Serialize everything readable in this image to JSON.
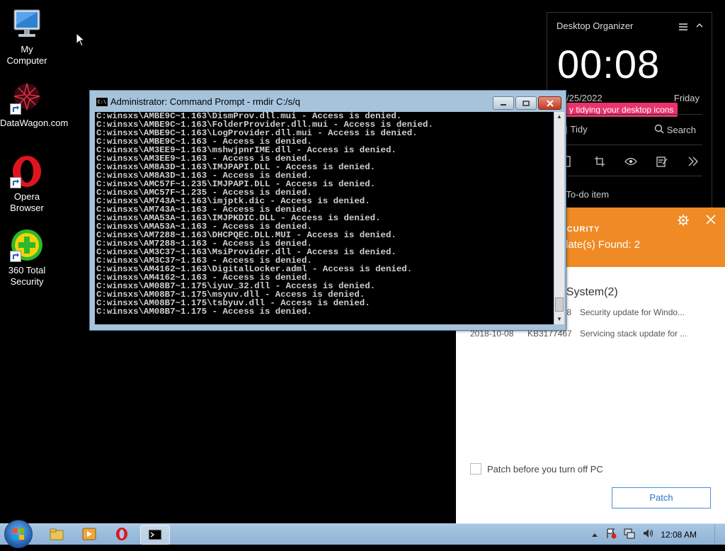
{
  "desktop": {
    "icons": [
      {
        "label": "My Computer",
        "icon": "computer-icon"
      },
      {
        "label": "DataWagon.com",
        "icon": "datawagon-icon"
      },
      {
        "label": "Opera Browser",
        "icon": "opera-icon"
      },
      {
        "label": "360 Total Security",
        "icon": "360-security-icon"
      }
    ]
  },
  "organizer": {
    "title": "Desktop Organizer",
    "time": "00:08",
    "date_partial": "/25/2022",
    "day": "Friday",
    "tip": "y tidying your desktop icons",
    "tidy_label": "Tidy",
    "search_label": "Search",
    "todo_label": "To-do item"
  },
  "security": {
    "brand": "SECURITY",
    "found": "date(s) Found: 2",
    "group": "r System(2)",
    "updates": [
      {
        "date": "",
        "kb": "8",
        "title": "Security update for Windo..."
      },
      {
        "date": "2018-10-08",
        "kb": "KB3177467",
        "title": "Servicing stack update for ..."
      }
    ],
    "checkbox_label": "Patch before you turn off PC",
    "patch_button": "Patch",
    "accent": "#f08a24"
  },
  "cmd": {
    "title": "Administrator: Command Prompt - rmdir  C:/s/q",
    "lines": [
      "C:winsxs\\AMBE9C~1.163\\DismProv.dll.mui - Access is denied.",
      "C:winsxs\\AMBE9C~1.163\\FolderProvider.dll.mui - Access is denied.",
      "C:winsxs\\AMBE9C~1.163\\LogProvider.dll.mui - Access is denied.",
      "C:winsxs\\AMBE9C~1.163 - Access is denied.",
      "C:winsxs\\AM3EE9~1.163\\mshwjpnrIME.dll - Access is denied.",
      "C:winsxs\\AM3EE9~1.163 - Access is denied.",
      "C:winsxs\\AM8A3D~1.163\\IMJPAPI.DLL - Access is denied.",
      "C:winsxs\\AM8A3D~1.163 - Access is denied.",
      "C:winsxs\\AMC57F~1.235\\IMJPAPI.DLL - Access is denied.",
      "C:winsxs\\AMC57F~1.235 - Access is denied.",
      "C:winsxs\\AM743A~1.163\\imjptk.dic - Access is denied.",
      "C:winsxs\\AM743A~1.163 - Access is denied.",
      "C:winsxs\\AMA53A~1.163\\IMJPKDIC.DLL - Access is denied.",
      "C:winsxs\\AMA53A~1.163 - Access is denied.",
      "C:winsxs\\AM7288~1.163\\DHCPQEC.DLL.MUI - Access is denied.",
      "C:winsxs\\AM7288~1.163 - Access is denied.",
      "C:winsxs\\AM3C37~1.163\\MsiProvider.dll - Access is denied.",
      "C:winsxs\\AM3C37~1.163 - Access is denied.",
      "C:winsxs\\AM4162~1.163\\DigitalLocker.adml - Access is denied.",
      "C:winsxs\\AM4162~1.163 - Access is denied.",
      "C:winsxs\\AM08B7~1.175\\iyuv_32.dll - Access is denied.",
      "C:winsxs\\AM08B7~1.175\\msyuv.dll - Access is denied.",
      "C:winsxs\\AM08B7~1.175\\tsbyuv.dll - Access is denied.",
      "C:winsxs\\AM08B7~1.175 - Access is denied."
    ]
  },
  "taskbar": {
    "clock": "12:08 AM",
    "apps": [
      "explorer-icon",
      "media-player-icon",
      "opera-icon",
      "cmd-icon"
    ]
  }
}
